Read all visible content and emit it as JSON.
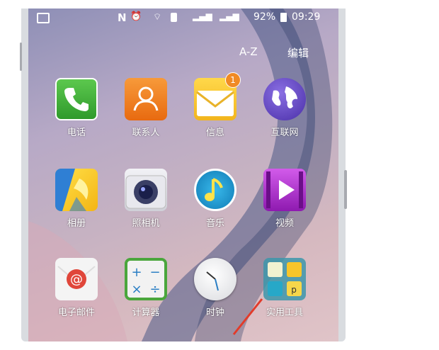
{
  "status_bar": {
    "nfc": "N",
    "battery_percent": "92%",
    "time": "09:29"
  },
  "top_actions": {
    "sort_label": "A-Z",
    "edit_label": "编辑"
  },
  "apps": [
    {
      "label": "电话",
      "icon": "phone-icon",
      "color": "#3fae3b"
    },
    {
      "label": "联系人",
      "icon": "contacts-icon",
      "color": "#f07c1c"
    },
    {
      "label": "信息",
      "icon": "messages-icon",
      "color": "#f7c52a",
      "badge": "1"
    },
    {
      "label": "互联网",
      "icon": "internet-icon",
      "color": "#5a43b5"
    },
    {
      "label": "相册",
      "icon": "gallery-icon",
      "color": "#2f7fd4"
    },
    {
      "label": "照相机",
      "icon": "camera-icon",
      "color": "#e4e4ea"
    },
    {
      "label": "音乐",
      "icon": "music-icon",
      "color": "#1c9ed8"
    },
    {
      "label": "视频",
      "icon": "video-icon",
      "color": "#b52ad0"
    },
    {
      "label": "电子邮件",
      "icon": "email-icon",
      "color": "#ffffff"
    },
    {
      "label": "计算器",
      "icon": "calculator-icon",
      "color": "#4aa63c"
    },
    {
      "label": "时钟",
      "icon": "clock-icon",
      "color": "#ffffff"
    },
    {
      "label": "实用工具",
      "icon": "tools-folder-icon",
      "color": "#3a9ab0"
    }
  ]
}
